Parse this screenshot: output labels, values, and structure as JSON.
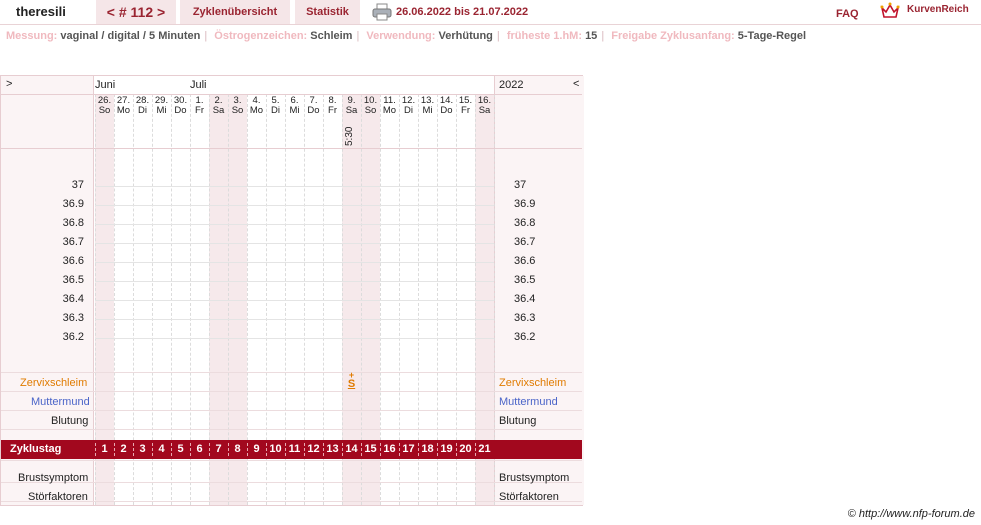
{
  "header": {
    "user": "theresili",
    "cycle": "< # 112 >",
    "tabs": [
      "Zyklenübersicht",
      "Statistik"
    ],
    "date_range": "26.06.2022 bis 21.07.2022",
    "faq": "FAQ",
    "brand": "KurvenReich"
  },
  "info": [
    {
      "label": "Messung:",
      "value": "vaginal / digital / 5 Minuten"
    },
    {
      "label": "Östrogenzeichen:",
      "value": "Schleim"
    },
    {
      "label": "Verwendung:",
      "value": "Verhütung"
    },
    {
      "label": "früheste 1.hM:",
      "value": "15"
    },
    {
      "label": "Freigabe Zyklusanfang:",
      "value": "5-Tage-Regel"
    }
  ],
  "chart": {
    "nav_left": ">",
    "nav_right": "<",
    "year": "2022",
    "months": [
      {
        "name": "Juni",
        "col": 0
      },
      {
        "name": "Juli",
        "col": 5
      }
    ],
    "days": [
      {
        "d": "26.",
        "w": "So",
        "shade": true
      },
      {
        "d": "27.",
        "w": "Mo"
      },
      {
        "d": "28.",
        "w": "Di"
      },
      {
        "d": "29.",
        "w": "Mi"
      },
      {
        "d": "30.",
        "w": "Do"
      },
      {
        "d": "1.",
        "w": "Fr"
      },
      {
        "d": "2.",
        "w": "Sa",
        "shade": true
      },
      {
        "d": "3.",
        "w": "So",
        "shade": true
      },
      {
        "d": "4.",
        "w": "Mo"
      },
      {
        "d": "5.",
        "w": "Di"
      },
      {
        "d": "6.",
        "w": "Mi"
      },
      {
        "d": "7.",
        "w": "Do"
      },
      {
        "d": "8.",
        "w": "Fr"
      },
      {
        "d": "9.",
        "w": "Sa",
        "shade": true,
        "time": "5:30"
      },
      {
        "d": "10.",
        "w": "So",
        "shade": true
      },
      {
        "d": "11.",
        "w": "Mo"
      },
      {
        "d": "12.",
        "w": "Di"
      },
      {
        "d": "13.",
        "w": "Mi"
      },
      {
        "d": "14.",
        "w": "Do"
      },
      {
        "d": "15.",
        "w": "Fr"
      },
      {
        "d": "16.",
        "w": "Sa",
        "shade": true
      }
    ],
    "temps": [
      "37",
      "36.9",
      "36.8",
      "36.7",
      "36.6",
      "36.5",
      "36.4",
      "36.3",
      "36.2"
    ],
    "rows": {
      "zervix": "Zervixschleim",
      "muttermund": "Muttermund",
      "blutung": "Blutung",
      "zyklustag": "Zyklustag",
      "brust": "Brustsymptom",
      "stoer": "Störfaktoren"
    },
    "cycle_days": [
      "1",
      "2",
      "3",
      "4",
      "5",
      "6",
      "7",
      "8",
      "9",
      "10",
      "11",
      "12",
      "13",
      "14",
      "15",
      "16",
      "17",
      "18",
      "19",
      "20",
      "21"
    ],
    "mucus_mark": {
      "day_index": 13,
      "symbol": "S",
      "modifier": "+"
    },
    "colors": {
      "accent": "#a2081e",
      "zervix": "#e07b00",
      "muttermund": "#4a64c8"
    }
  },
  "footer": {
    "copyright": "© http://www.nfp-forum.de"
  }
}
